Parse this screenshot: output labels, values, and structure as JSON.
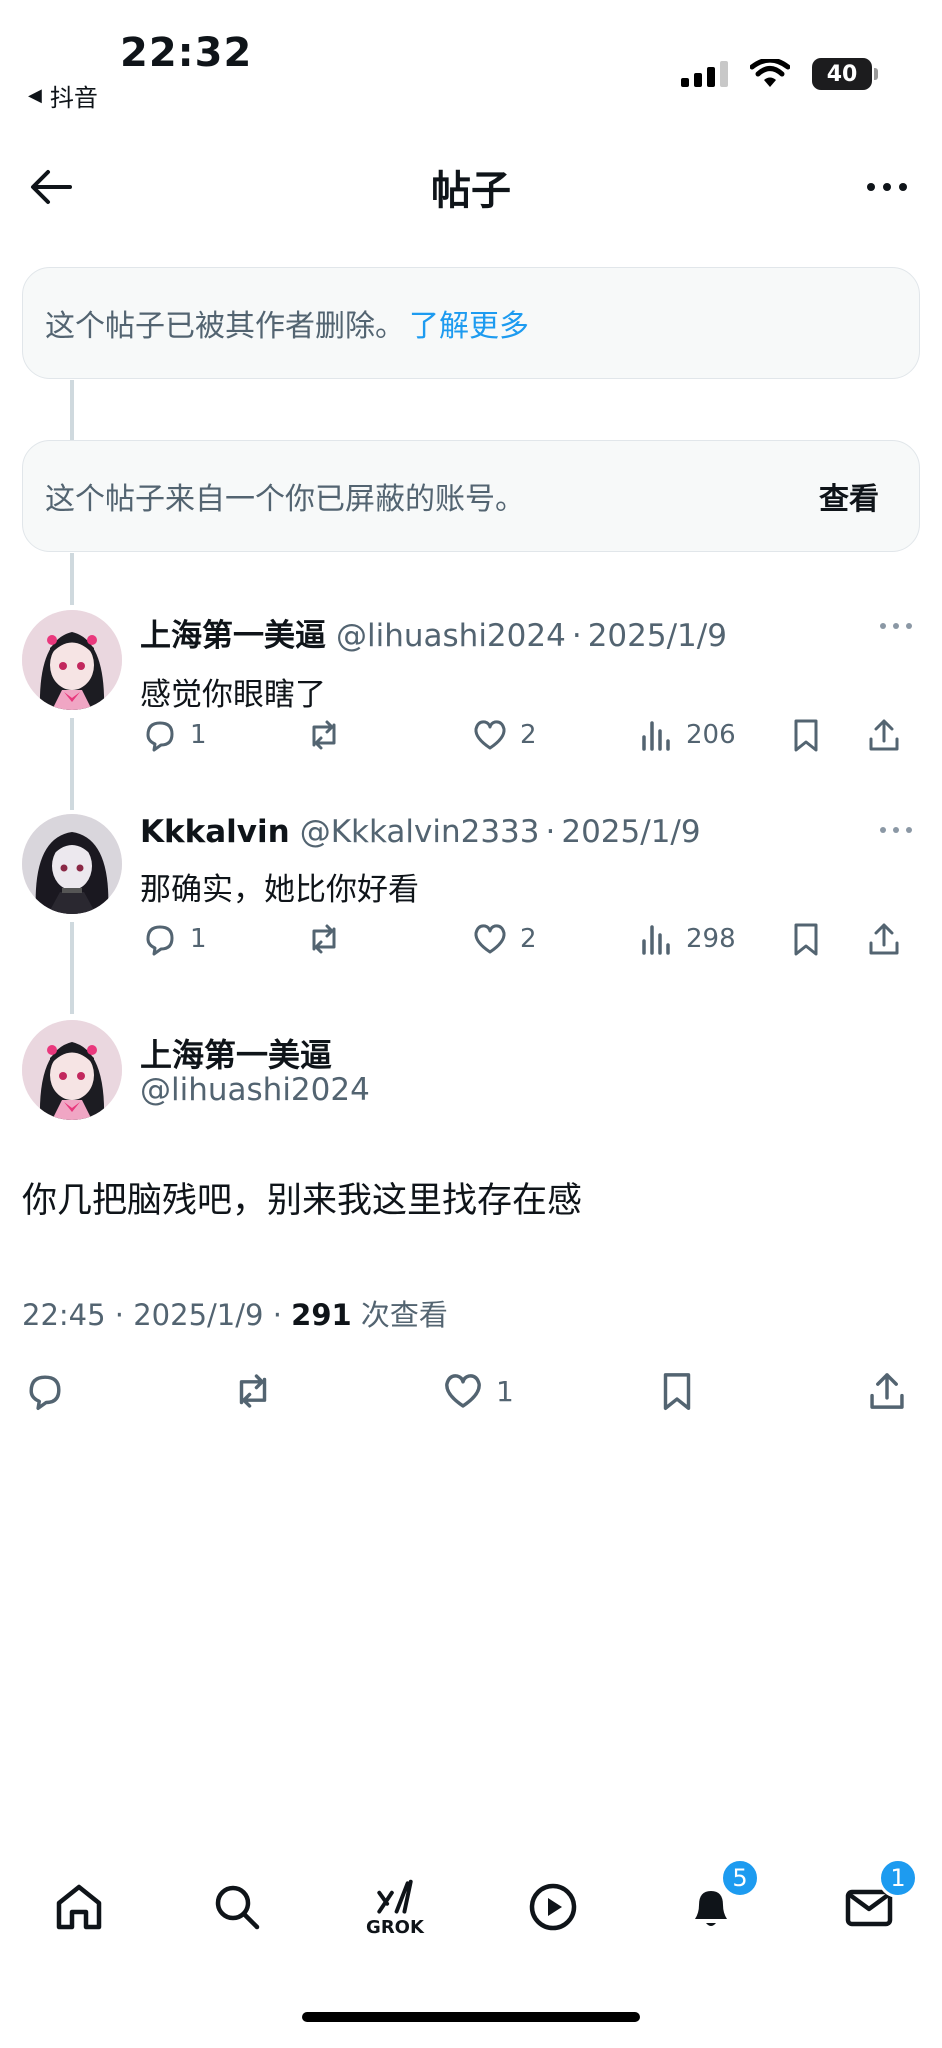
{
  "status_bar": {
    "time": "22:32",
    "back_app": "抖音",
    "battery": "40"
  },
  "header": {
    "title": "帖子"
  },
  "notices": {
    "deleted_text": "这个帖子已被其作者删除。",
    "deleted_link": "了解更多",
    "blocked_text": "这个帖子来自一个你已屏蔽的账号。",
    "blocked_action": "查看"
  },
  "replies": [
    {
      "name": "上海第一美逼",
      "handle": "@lihuashi2024",
      "date": "2025/1/9",
      "text": "感觉你眼瞎了",
      "comments": "1",
      "likes": "2",
      "views": "206"
    },
    {
      "name": "Kkkalvin",
      "handle": "@Kkkalvin2333",
      "date": "2025/1/9",
      "text": "那确实，她比你好看",
      "comments": "1",
      "likes": "2",
      "views": "298"
    }
  ],
  "main_post": {
    "name": "上海第一美逼",
    "handle": "@lihuashi2024",
    "text": "你几把脑残吧，别来我这里找存在感",
    "time": "22:45",
    "date": "2025/1/9",
    "view_count": "291",
    "view_label": "次查看",
    "likes": "1"
  },
  "tabbar": {
    "grok_label": "GROK",
    "notifications_badge": "5",
    "messages_badge": "1"
  },
  "colors": {
    "accent": "#1d9bf0",
    "secondary_text": "#536471",
    "notice_bg": "#f7f9f9"
  }
}
